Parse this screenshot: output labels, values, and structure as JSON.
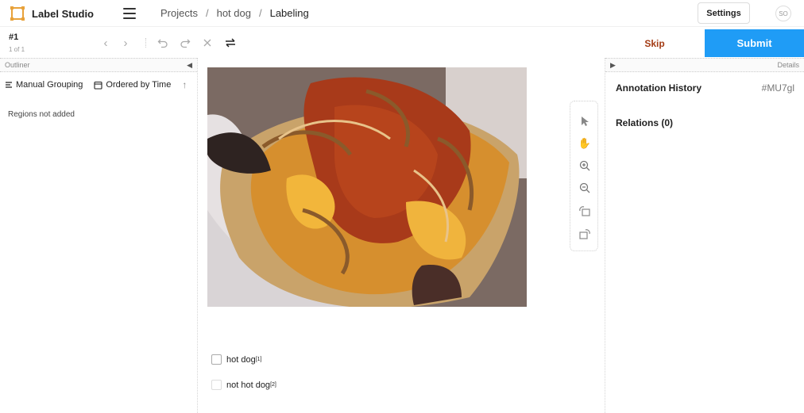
{
  "app": {
    "name": "Label Studio"
  },
  "breadcrumb": {
    "items": [
      "Projects",
      "hot dog",
      "Labeling"
    ],
    "separator": "/"
  },
  "header": {
    "settings_label": "Settings",
    "avatar_initials": "SO"
  },
  "task": {
    "id": "#1",
    "count": "1 of 1"
  },
  "actions": {
    "skip_label": "Skip",
    "submit_label": "Submit",
    "submit_color": "#1f9cf6",
    "skip_color": "#a33b14"
  },
  "outliner": {
    "title": "Outliner",
    "grouping_label": "Manual Grouping",
    "ordering_label": "Ordered by Time",
    "empty_message": "Regions not added"
  },
  "details": {
    "title": "Details",
    "annotation_history_label": "Annotation History",
    "annotation_id": "#MU7gl",
    "relations_label": "Relations (0)"
  },
  "choices": [
    {
      "label": "hot dog",
      "hotkey": "[1]"
    },
    {
      "label": "not hot dog",
      "hotkey": "[2]"
    }
  ],
  "image": {
    "alt": "hot dog with cheese, fried onions and ketchup"
  }
}
